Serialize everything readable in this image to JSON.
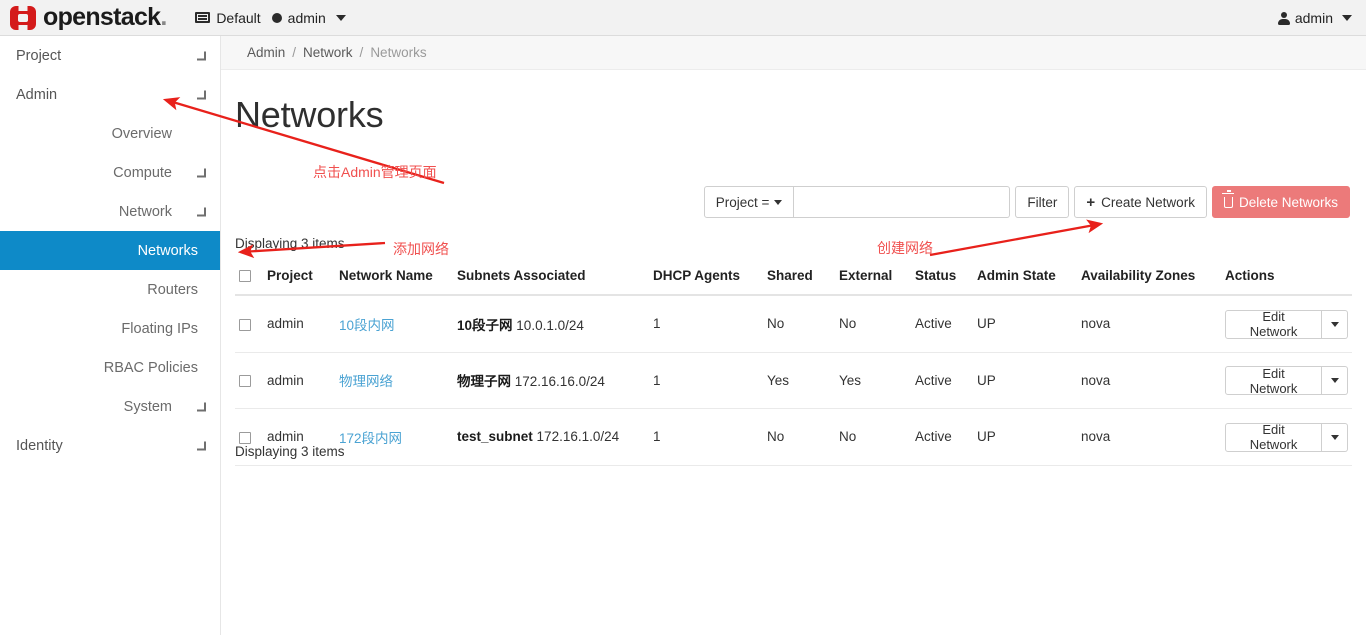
{
  "topbar": {
    "brand": "openstack",
    "brand_dot": ".",
    "logo_icon": "openstack-logo-icon",
    "domain_icon": "card-icon",
    "domain_label": "Default",
    "project_dot_icon": "dot-icon",
    "project_label": "admin",
    "context_caret_icon": "caret-down-icon",
    "user_icon": "user-icon",
    "user_label": "admin",
    "user_caret_icon": "caret-down-icon"
  },
  "sidebar": {
    "items": [
      {
        "label": "Project",
        "level": 0,
        "chevron": "chevron-right-icon",
        "active": false
      },
      {
        "label": "Admin",
        "level": 0,
        "chevron": "chevron-down-icon",
        "active": false
      },
      {
        "label": "Overview",
        "level": 1,
        "chevron": "",
        "active": false
      },
      {
        "label": "Compute",
        "level": 1,
        "chevron": "chevron-right-icon",
        "active": false
      },
      {
        "label": "Network",
        "level": 1,
        "chevron": "chevron-down-icon",
        "active": false
      },
      {
        "label": "Networks",
        "level": 2,
        "chevron": "",
        "active": true
      },
      {
        "label": "Routers",
        "level": 2,
        "chevron": "",
        "active": false
      },
      {
        "label": "Floating IPs",
        "level": 2,
        "chevron": "",
        "active": false
      },
      {
        "label": "RBAC Policies",
        "level": 2,
        "chevron": "",
        "active": false
      },
      {
        "label": "System",
        "level": 1,
        "chevron": "chevron-right-icon",
        "active": false
      },
      {
        "label": "Identity",
        "level": 0,
        "chevron": "chevron-right-icon",
        "active": false
      }
    ],
    "active_color": "#0e8ac8"
  },
  "breadcrumb": {
    "items": [
      "Admin",
      "Network",
      "Networks"
    ],
    "separator": "/"
  },
  "page": {
    "title": "Networks",
    "count_top": "Displaying 3 items",
    "count_bottom": "Displaying 3 items"
  },
  "toolbar": {
    "filter_select_label": "Project =",
    "filter_select_caret": "caret-down-icon",
    "filter_input_value": "",
    "filter_input_placeholder": "",
    "filter_button": "Filter",
    "create_icon": "plus-icon",
    "create_button": "Create Network",
    "delete_icon": "trash-icon",
    "delete_button": "Delete Networks",
    "delete_color": "#ec7a7a"
  },
  "table": {
    "select_all_icon": "checkbox-icon",
    "columns": [
      "Project",
      "Network Name",
      "Subnets Associated",
      "DHCP Agents",
      "Shared",
      "External",
      "Status",
      "Admin State",
      "Availability Zones",
      "Actions"
    ],
    "rows": [
      {
        "project": "admin",
        "network_name": "10段内网",
        "subnet_name": "10段子网",
        "subnet_cidr": "10.0.1.0/24",
        "dhcp_agents": "1",
        "shared": "No",
        "external": "No",
        "status": "Active",
        "admin_state": "UP",
        "availability_zones": "nova",
        "action_label": "Edit Network",
        "action_caret_icon": "caret-down-icon"
      },
      {
        "project": "admin",
        "network_name": "物理网络",
        "subnet_name": "物理子网",
        "subnet_cidr": "172.16.16.0/24",
        "dhcp_agents": "1",
        "shared": "Yes",
        "external": "Yes",
        "status": "Active",
        "admin_state": "UP",
        "availability_zones": "nova",
        "action_label": "Edit Network",
        "action_caret_icon": "caret-down-icon"
      },
      {
        "project": "admin",
        "network_name": "172段内网",
        "subnet_name": "test_subnet",
        "subnet_cidr": "172.16.1.0/24",
        "dhcp_agents": "1",
        "shared": "No",
        "external": "No",
        "status": "Active",
        "admin_state": "UP",
        "availability_zones": "nova",
        "action_label": "Edit Network",
        "action_caret_icon": "caret-down-icon"
      }
    ]
  },
  "annotations": {
    "color": "#f0504f",
    "notes": [
      {
        "text": "点击Admin管理页面"
      },
      {
        "text": "添加网络"
      },
      {
        "text": "创建网络"
      }
    ]
  }
}
